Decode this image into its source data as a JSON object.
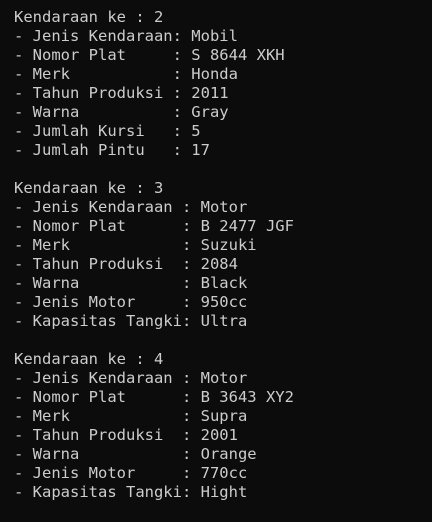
{
  "terminal": {
    "background": "#0c0c0c",
    "foreground": "#cccccc",
    "lines": [
      "Kendaraan ke : 2",
      "- Jenis Kendaraan: Mobil",
      "- Nomor Plat     : S 8644 XKH",
      "- Merk           : Honda",
      "- Tahun Produksi : 2011",
      "- Warna          : Gray",
      "- Jumlah Kursi   : 5",
      "- Jumlah Pintu   : 17",
      "",
      "Kendaraan ke : 3",
      "- Jenis Kendaraan : Motor",
      "- Nomor Plat      : B 2477 JGF",
      "- Merk            : Suzuki",
      "- Tahun Produksi  : 2084",
      "- Warna           : Black",
      "- Jenis Motor     : 950cc",
      "- Kapasitas Tangki: Ultra",
      "",
      "Kendaraan ke : 4",
      "- Jenis Kendaraan : Motor",
      "- Nomor Plat      : B 3643 XY2",
      "- Merk            : Supra",
      "- Tahun Produksi  : 2001",
      "- Warna           : Orange",
      "- Jenis Motor     : 770cc",
      "- Kapasitas Tangki: Hight"
    ]
  }
}
